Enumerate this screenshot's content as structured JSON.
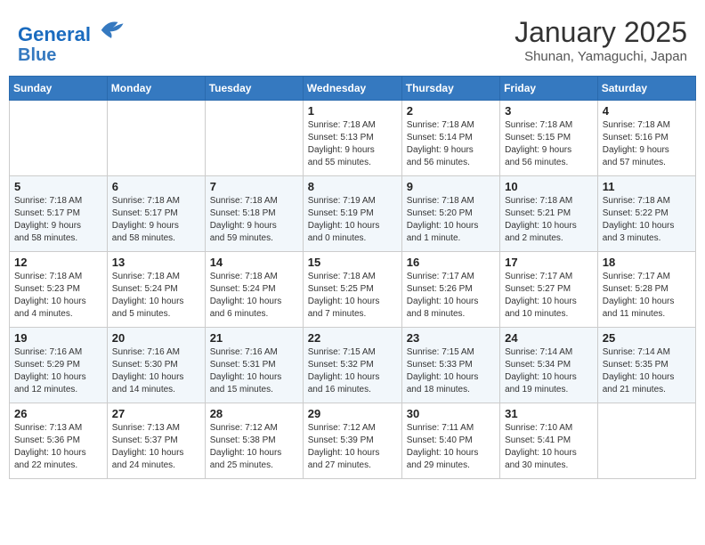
{
  "header": {
    "logo_line1": "General",
    "logo_line2": "Blue",
    "title": "January 2025",
    "subtitle": "Shunan, Yamaguchi, Japan"
  },
  "weekdays": [
    "Sunday",
    "Monday",
    "Tuesday",
    "Wednesday",
    "Thursday",
    "Friday",
    "Saturday"
  ],
  "weeks": [
    [
      {
        "day": "",
        "info": ""
      },
      {
        "day": "",
        "info": ""
      },
      {
        "day": "",
        "info": ""
      },
      {
        "day": "1",
        "info": "Sunrise: 7:18 AM\nSunset: 5:13 PM\nDaylight: 9 hours\nand 55 minutes."
      },
      {
        "day": "2",
        "info": "Sunrise: 7:18 AM\nSunset: 5:14 PM\nDaylight: 9 hours\nand 56 minutes."
      },
      {
        "day": "3",
        "info": "Sunrise: 7:18 AM\nSunset: 5:15 PM\nDaylight: 9 hours\nand 56 minutes."
      },
      {
        "day": "4",
        "info": "Sunrise: 7:18 AM\nSunset: 5:16 PM\nDaylight: 9 hours\nand 57 minutes."
      }
    ],
    [
      {
        "day": "5",
        "info": "Sunrise: 7:18 AM\nSunset: 5:17 PM\nDaylight: 9 hours\nand 58 minutes."
      },
      {
        "day": "6",
        "info": "Sunrise: 7:18 AM\nSunset: 5:17 PM\nDaylight: 9 hours\nand 58 minutes."
      },
      {
        "day": "7",
        "info": "Sunrise: 7:18 AM\nSunset: 5:18 PM\nDaylight: 9 hours\nand 59 minutes."
      },
      {
        "day": "8",
        "info": "Sunrise: 7:19 AM\nSunset: 5:19 PM\nDaylight: 10 hours\nand 0 minutes."
      },
      {
        "day": "9",
        "info": "Sunrise: 7:18 AM\nSunset: 5:20 PM\nDaylight: 10 hours\nand 1 minute."
      },
      {
        "day": "10",
        "info": "Sunrise: 7:18 AM\nSunset: 5:21 PM\nDaylight: 10 hours\nand 2 minutes."
      },
      {
        "day": "11",
        "info": "Sunrise: 7:18 AM\nSunset: 5:22 PM\nDaylight: 10 hours\nand 3 minutes."
      }
    ],
    [
      {
        "day": "12",
        "info": "Sunrise: 7:18 AM\nSunset: 5:23 PM\nDaylight: 10 hours\nand 4 minutes."
      },
      {
        "day": "13",
        "info": "Sunrise: 7:18 AM\nSunset: 5:24 PM\nDaylight: 10 hours\nand 5 minutes."
      },
      {
        "day": "14",
        "info": "Sunrise: 7:18 AM\nSunset: 5:24 PM\nDaylight: 10 hours\nand 6 minutes."
      },
      {
        "day": "15",
        "info": "Sunrise: 7:18 AM\nSunset: 5:25 PM\nDaylight: 10 hours\nand 7 minutes."
      },
      {
        "day": "16",
        "info": "Sunrise: 7:17 AM\nSunset: 5:26 PM\nDaylight: 10 hours\nand 8 minutes."
      },
      {
        "day": "17",
        "info": "Sunrise: 7:17 AM\nSunset: 5:27 PM\nDaylight: 10 hours\nand 10 minutes."
      },
      {
        "day": "18",
        "info": "Sunrise: 7:17 AM\nSunset: 5:28 PM\nDaylight: 10 hours\nand 11 minutes."
      }
    ],
    [
      {
        "day": "19",
        "info": "Sunrise: 7:16 AM\nSunset: 5:29 PM\nDaylight: 10 hours\nand 12 minutes."
      },
      {
        "day": "20",
        "info": "Sunrise: 7:16 AM\nSunset: 5:30 PM\nDaylight: 10 hours\nand 14 minutes."
      },
      {
        "day": "21",
        "info": "Sunrise: 7:16 AM\nSunset: 5:31 PM\nDaylight: 10 hours\nand 15 minutes."
      },
      {
        "day": "22",
        "info": "Sunrise: 7:15 AM\nSunset: 5:32 PM\nDaylight: 10 hours\nand 16 minutes."
      },
      {
        "day": "23",
        "info": "Sunrise: 7:15 AM\nSunset: 5:33 PM\nDaylight: 10 hours\nand 18 minutes."
      },
      {
        "day": "24",
        "info": "Sunrise: 7:14 AM\nSunset: 5:34 PM\nDaylight: 10 hours\nand 19 minutes."
      },
      {
        "day": "25",
        "info": "Sunrise: 7:14 AM\nSunset: 5:35 PM\nDaylight: 10 hours\nand 21 minutes."
      }
    ],
    [
      {
        "day": "26",
        "info": "Sunrise: 7:13 AM\nSunset: 5:36 PM\nDaylight: 10 hours\nand 22 minutes."
      },
      {
        "day": "27",
        "info": "Sunrise: 7:13 AM\nSunset: 5:37 PM\nDaylight: 10 hours\nand 24 minutes."
      },
      {
        "day": "28",
        "info": "Sunrise: 7:12 AM\nSunset: 5:38 PM\nDaylight: 10 hours\nand 25 minutes."
      },
      {
        "day": "29",
        "info": "Sunrise: 7:12 AM\nSunset: 5:39 PM\nDaylight: 10 hours\nand 27 minutes."
      },
      {
        "day": "30",
        "info": "Sunrise: 7:11 AM\nSunset: 5:40 PM\nDaylight: 10 hours\nand 29 minutes."
      },
      {
        "day": "31",
        "info": "Sunrise: 7:10 AM\nSunset: 5:41 PM\nDaylight: 10 hours\nand 30 minutes."
      },
      {
        "day": "",
        "info": ""
      }
    ]
  ]
}
